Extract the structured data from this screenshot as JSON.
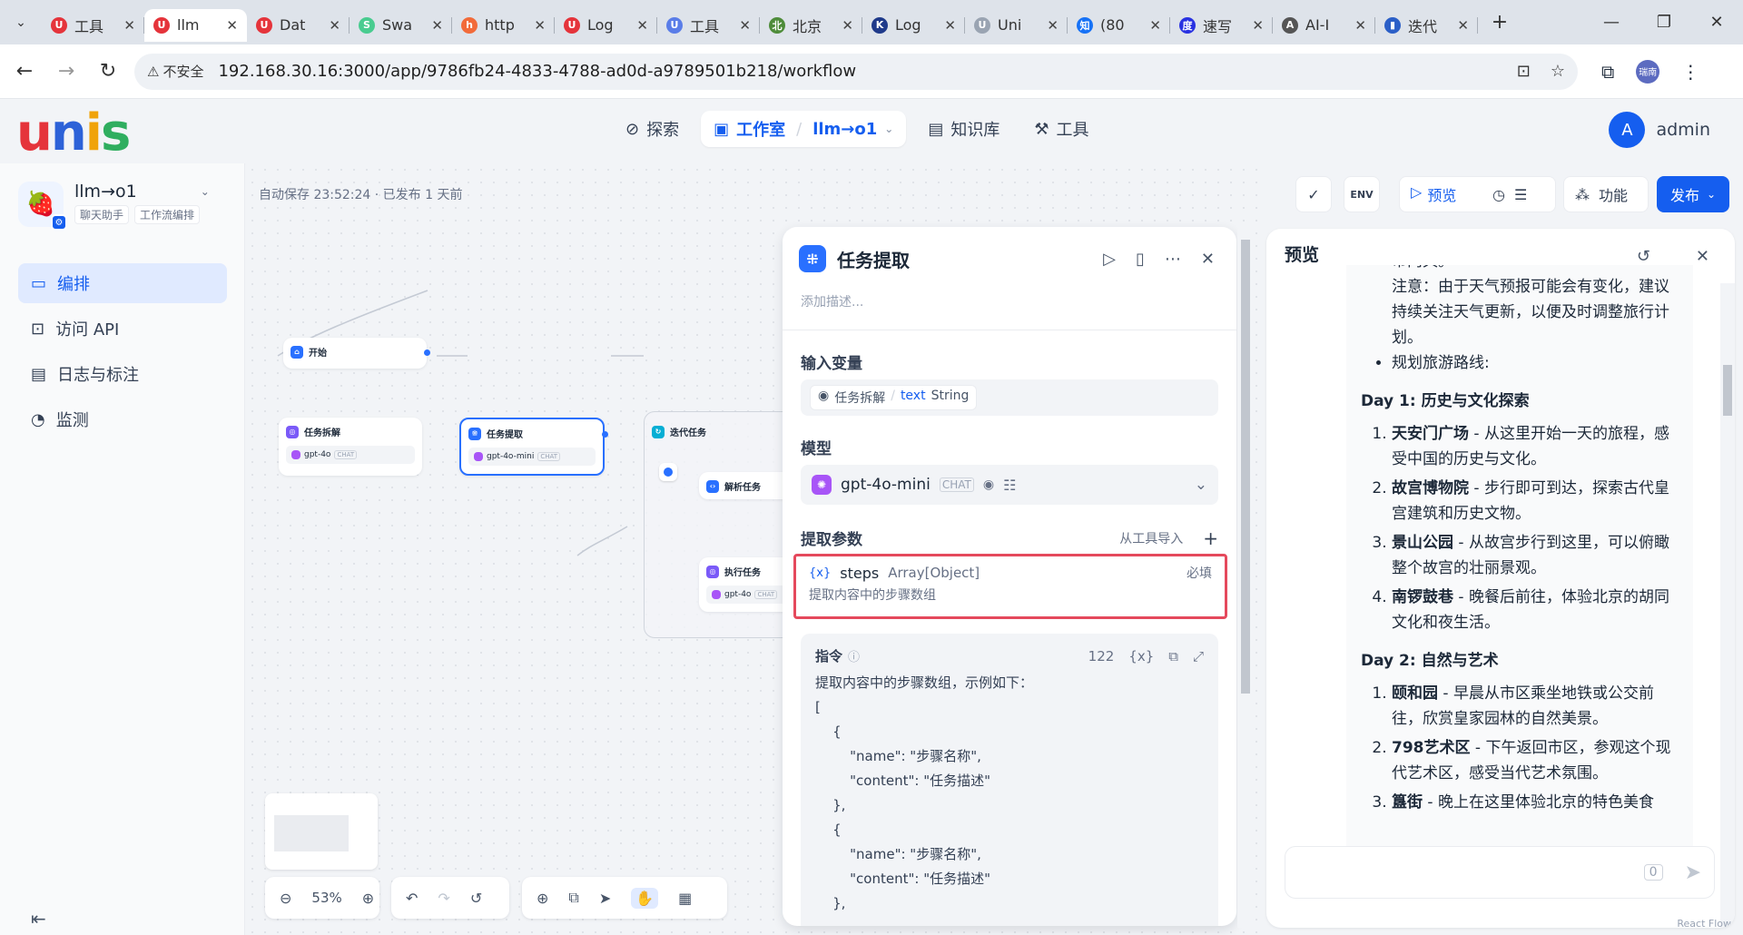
{
  "browser": {
    "tabs": [
      {
        "label": "工具",
        "icon_text": "U",
        "icon_color": "#e5343b"
      },
      {
        "label": "llm",
        "icon_text": "U",
        "icon_color": "#e5343b",
        "active": true
      },
      {
        "label": "Dat",
        "icon_text": "U",
        "icon_color": "#e5343b"
      },
      {
        "label": "Swa",
        "icon_text": "S",
        "icon_color": "#49cc90"
      },
      {
        "label": "http",
        "icon_text": "h",
        "icon_color": "#f26b3a"
      },
      {
        "label": "Log",
        "icon_text": "U",
        "icon_color": "#e5343b"
      },
      {
        "label": "工具",
        "icon_text": "U",
        "icon_color": "#5a7de8"
      },
      {
        "label": "北京",
        "icon_text": "北",
        "icon_color": "#4e8c3a"
      },
      {
        "label": "Log",
        "icon_text": "K",
        "icon_color": "#1f3a8a"
      },
      {
        "label": "Uni",
        "icon_text": "U",
        "icon_color": "#9aa4b2"
      },
      {
        "label": "(80",
        "icon_text": "知",
        "icon_color": "#1772f6"
      },
      {
        "label": "速写",
        "icon_text": "度",
        "icon_color": "#2932e1"
      },
      {
        "label": "AI-I",
        "icon_text": "A",
        "icon_color": "#555"
      },
      {
        "label": "迭代",
        "icon_text": "▮",
        "icon_color": "#2b5fc7"
      }
    ],
    "security_label": "不安全",
    "url": "192.168.30.16:3000/app/9786fb24-4833-4788-ad0d-a9789501b218/workflow",
    "profile_label": "瑞南"
  },
  "header": {
    "logo": "unis",
    "nav": {
      "explore": "探索",
      "studio": "工作室",
      "app_name": "llm→o1",
      "knowledge": "知识库",
      "tools": "工具"
    },
    "user_initial": "A",
    "user_name": "admin"
  },
  "sidebar": {
    "app_name": "llm→o1",
    "tags": [
      "聊天助手",
      "工作流编排"
    ],
    "items": [
      {
        "label": "编排",
        "icon": "layout-icon",
        "active": true
      },
      {
        "label": "访问 API",
        "icon": "terminal-icon"
      },
      {
        "label": "日志与标注",
        "icon": "file-icon"
      },
      {
        "label": "监测",
        "icon": "gauge-icon"
      }
    ]
  },
  "canvas": {
    "autosave": "自动保存 23:52:24 · 已发布 1 天前",
    "nodes": {
      "start": "开始",
      "task_split": "任务拆解",
      "task_split_model": "gpt-4o",
      "task_extract": "任务提取",
      "task_extract_model": "gpt-4o-mini",
      "iterate": "迭代任务",
      "parse": "解析任务",
      "exec": "执行任务",
      "exec_model": "gpt-4o",
      "chat_chip": "CHAT"
    },
    "zoom": "53%"
  },
  "toolbar": {
    "preview": "预览",
    "features": "功能",
    "publish": "发布"
  },
  "panel": {
    "title": "任务提取",
    "desc_placeholder": "添加描述...",
    "input_vars_title": "输入变量",
    "input_var_node": "任务拆解",
    "input_var_name": "text",
    "input_var_type": "String",
    "model_title": "模型",
    "model_name": "gpt-4o-mini",
    "model_mode": "CHAT",
    "extract_title": "提取参数",
    "import_from_tool": "从工具导入",
    "param": {
      "name": "steps",
      "type": "Array[Object]",
      "required": "必填",
      "desc": "提取内容中的步骤数组"
    },
    "instruction_title": "指令",
    "instruction_count": "122",
    "instruction_text": "提取内容中的步骤数组，示例如下：\n[\n    {\n        \"name\": \"步骤名称\",\n        \"content\": \"任务描述\"\n    },\n    {\n        \"name\": \"步骤名称\",\n        \"content\": \"任务描述\"\n    },"
  },
  "preview": {
    "title": "预览",
    "intro_cut": "市两具。",
    "note": "注意：由于天气预报可能会有变化，建议持续关注天气更新，以便及时调整旅行计划。",
    "bullet": "规划旅游路线:",
    "day1_title": "Day 1: 历史与文化探索",
    "day1": [
      {
        "name": "天安门广场",
        "text": " - 从这里开始一天的旅程，感受中国的历史与文化。"
      },
      {
        "name": "故宫博物院",
        "text": " - 步行即可到达，探索古代皇宫建筑和历史文物。"
      },
      {
        "name": "景山公园",
        "text": " - 从故宫步行到这里，可以俯瞰整个故宫的壮丽景观。"
      },
      {
        "name": "南锣鼓巷",
        "text": " - 晚餐后前往，体验北京的胡同文化和夜生活。"
      }
    ],
    "day2_title": "Day 2: 自然与艺术",
    "day2": [
      {
        "name": "颐和园",
        "text": " - 早晨从市区乘坐地铁或公交前往，欣赏皇家园林的自然美景。"
      },
      {
        "name": "798艺术区",
        "text": " - 下午返回市区，参观这个现代艺术区，感受当代艺术氛围。"
      },
      {
        "name": "簋街",
        "text": " - 晚上在这里体验北京的特色美食"
      }
    ],
    "char_count": "0",
    "corner": "React Flow"
  }
}
